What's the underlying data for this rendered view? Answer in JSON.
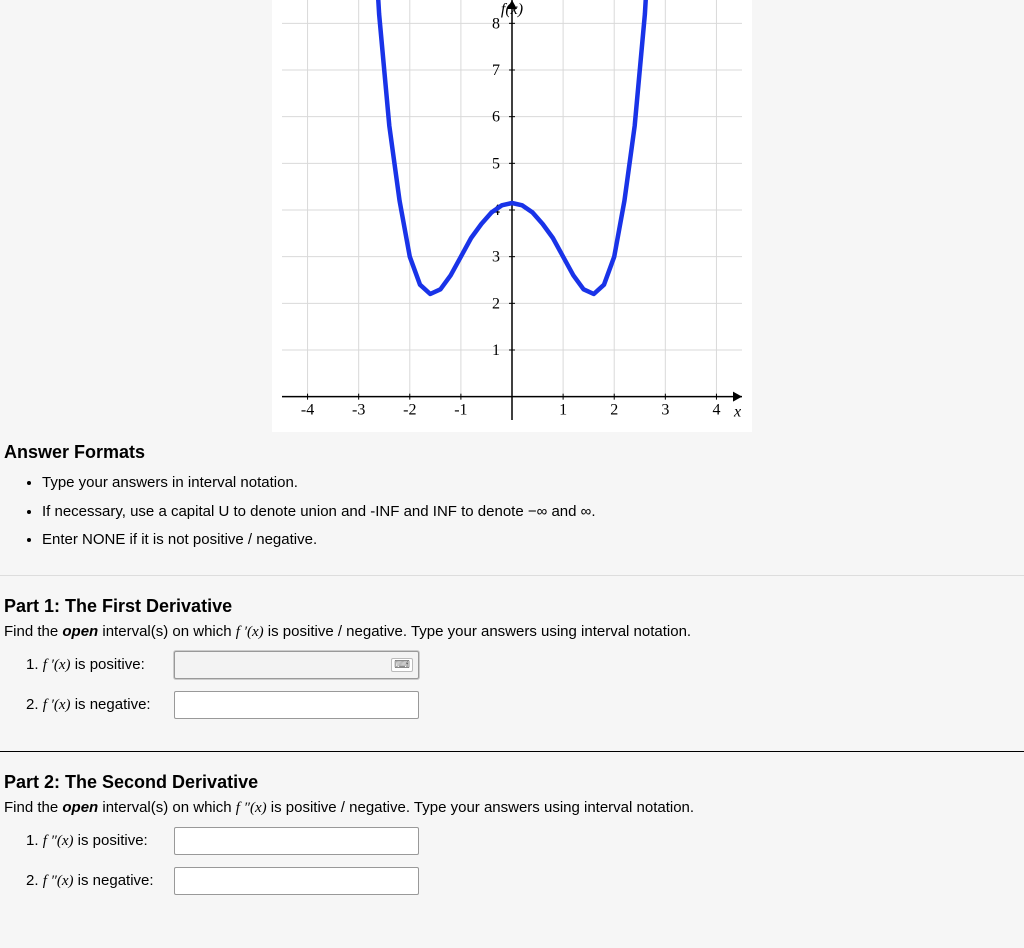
{
  "chart_data": {
    "type": "line",
    "title": "",
    "xlabel": "x",
    "ylabel": "f(x)",
    "xlim": [
      -4.5,
      4.5
    ],
    "ylim": [
      -0.5,
      8.5
    ],
    "xticks": [
      -4,
      -3,
      -2,
      -1,
      1,
      2,
      3,
      4
    ],
    "yticks": [
      1,
      2,
      3,
      4,
      5,
      6,
      7,
      8
    ],
    "x": [
      -2.75,
      -2.6,
      -2.4,
      -2.2,
      -2.0,
      -1.8,
      -1.6,
      -1.4,
      -1.2,
      -1.0,
      -0.8,
      -0.6,
      -0.4,
      -0.2,
      0.0,
      0.2,
      0.4,
      0.6,
      0.8,
      1.0,
      1.2,
      1.4,
      1.6,
      1.8,
      2.0,
      2.2,
      2.4,
      2.6,
      2.75
    ],
    "values": [
      11.0,
      8.2,
      5.8,
      4.2,
      3.0,
      2.4,
      2.2,
      2.3,
      2.6,
      3.0,
      3.4,
      3.7,
      3.95,
      4.1,
      4.15,
      4.1,
      3.95,
      3.7,
      3.4,
      3.0,
      2.6,
      2.3,
      2.2,
      2.4,
      3.0,
      4.2,
      5.8,
      8.2,
      11.0
    ],
    "series_color": "#1933e8",
    "grid": true
  },
  "answer_formats": {
    "heading": "Answer Formats",
    "bullets": [
      "Type your answers in interval notation.",
      "If necessary, use a capital U to denote union and -INF and INF to denote −∞ and ∞.",
      "Enter NONE if it is not positive / negative."
    ]
  },
  "part1": {
    "heading": "Part 1: The First Derivative",
    "prompt_prefix": "Find the ",
    "prompt_emph": "open",
    "prompt_mid": " interval(s) on which ",
    "prompt_func": "f ′(x)",
    "prompt_suffix": " is positive / negative. Type your answers using interval notation.",
    "q1_num": "1. ",
    "q1_func": "f ′(x)",
    "q1_text": " is positive:",
    "q2_num": "2. ",
    "q2_func": "f ′(x)",
    "q2_text": " is negative:",
    "input1": "",
    "input2": ""
  },
  "part2": {
    "heading": "Part 2: The Second Derivative",
    "prompt_prefix": "Find the ",
    "prompt_emph": "open",
    "prompt_mid": " interval(s) on which ",
    "prompt_func": "f ″(x)",
    "prompt_suffix": " is positive / negative. Type your answers using interval notation.",
    "q1_num": "1. ",
    "q1_func": "f ″(x)",
    "q1_text": " is positive:",
    "q2_num": "2. ",
    "q2_func": "f ″(x)",
    "q2_text": " is negative:",
    "input1": "",
    "input2": ""
  }
}
